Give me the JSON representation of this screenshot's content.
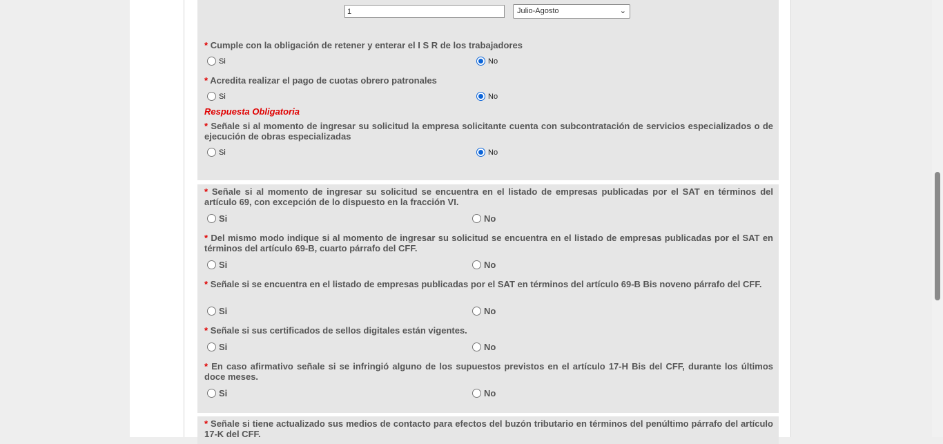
{
  "periodo": {
    "input_value": "1",
    "select_value": "Julio-Agosto"
  },
  "questions_top": [
    {
      "text": "Cumple con la obligación de retener y enterar el I S R de los trabajadores",
      "si": "Si",
      "no": "No",
      "selected": "no"
    },
    {
      "text": "Acredita realizar el pago de cuotas obrero patronales",
      "si": "Si",
      "no": "No",
      "selected": "no"
    },
    {
      "text": "Señale si al momento de ingresar su solicitud la empresa solicitante cuenta con subcontratación de servicios especializados o de ejecución de obras especializadas",
      "si": "Si",
      "no": "No",
      "selected": "no"
    }
  ],
  "required_message": "Respuesta Obligatoria",
  "questions_sat": [
    {
      "text": "Señale si al momento de ingresar su solicitud se encuentra en el listado de empresas publicadas por el SAT en términos del artículo 69, con excepción de lo dispuesto en la fracción VI.",
      "si": "Si",
      "no": "No"
    },
    {
      "text": "Del mismo modo indique si al momento de ingresar su solicitud se encuentra en el listado de empresas publicadas por el SAT en términos del artículo 69-B, cuarto párrafo del CFF.",
      "si": "Si",
      "no": "No"
    },
    {
      "text": "Señale si se encuentra en el listado de empresas publicadas por el SAT en términos del artículo 69-B Bis noveno párrafo del CFF.",
      "si": "Si",
      "no": "No"
    },
    {
      "text": "Señale si sus certificados de sellos digitales están vigentes.",
      "si": "Si",
      "no": "No"
    },
    {
      "text": "En caso afirmativo señale si se infringió alguno de los supuestos previstos en el artículo 17-H Bis del CFF, durante los últimos doce meses.",
      "si": "Si",
      "no": "No"
    }
  ],
  "questions_bottom": [
    {
      "text": "Señale si tiene actualizado sus medios de contacto para efectos del buzón tributario en términos del penúltimo párrafo del artículo 17-K del CFF."
    }
  ],
  "required_star": "*"
}
